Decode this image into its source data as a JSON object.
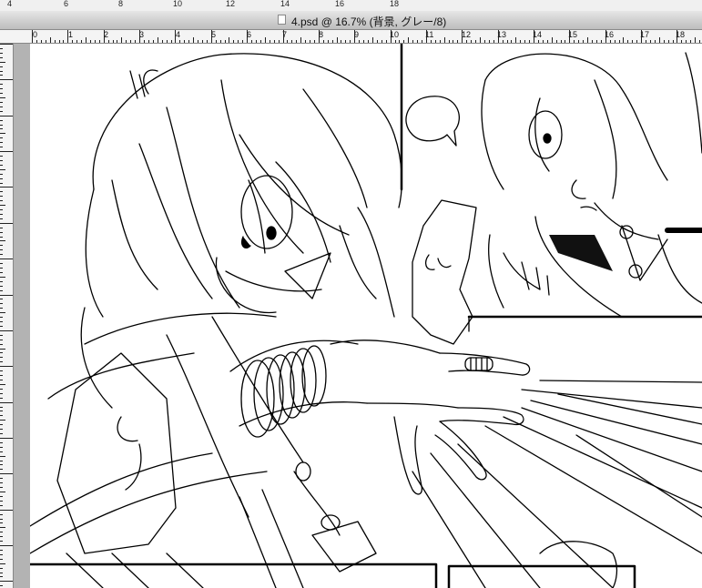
{
  "window": {
    "title": "4.psd @ 16.7% (背景, グレー/8)"
  },
  "top_ruler": {
    "labels": [
      "4",
      "6",
      "8",
      "10",
      "12",
      "14",
      "16",
      "18"
    ]
  },
  "ruler": {
    "labels": [
      "0",
      "1",
      "2",
      "3",
      "4",
      "5",
      "6",
      "7",
      "8",
      "9",
      "10",
      "11",
      "12",
      "13",
      "14",
      "15",
      "16",
      "17",
      "18"
    ]
  },
  "artwork": {
    "description_icon": "manga-lineart"
  }
}
